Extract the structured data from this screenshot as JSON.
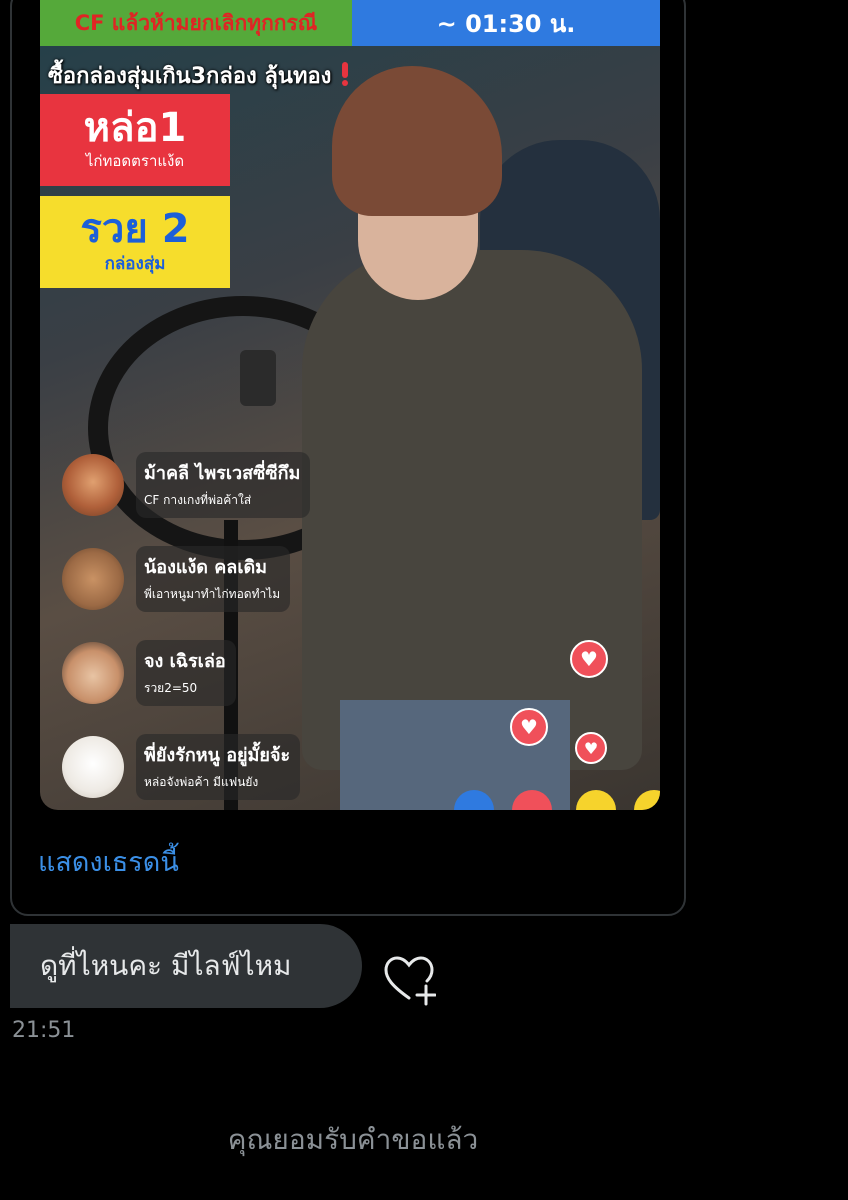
{
  "tweet": {
    "banner_left": "CF แล้วห้ามยกเลิกทุกกรณี",
    "banner_right": "~ 01:30 น.",
    "headline": "ซื้อกล่องสุ่มเกิน3กล่อง ลุ้นทอง",
    "red_box": {
      "title": "หล่อ1",
      "subtitle": "ไก่ทอดตราแง้ด"
    },
    "yellow_box": {
      "title": "รวย 2",
      "subtitle": "กล่องสุ่ม"
    },
    "comments": [
      {
        "name": "ม้าคลี ไพรเวสซี่ซีกึม",
        "text": "CF กางเกงที่พ่อค้าใส่"
      },
      {
        "name": "น้องแง้ด คลเดิม",
        "text": "พี่เอาหนูมาทำไก่ทอดทำไม"
      },
      {
        "name": "จง เฉิรเล่อ",
        "text": "รวย2=50"
      },
      {
        "name": "พี่ยังรักหนู อยู่มั้ยจ้ะ",
        "text": "หล่อจังพ่อค้า มีแฟนยัง"
      }
    ],
    "show_thread": "แสดงเธรดนี้"
  },
  "message": {
    "text": "ดูที่ไหนคะ มีไลฟ์ไหม",
    "time": "21:51"
  },
  "status": {
    "accepted": "คุณยอมรับคำขอแล้ว"
  },
  "icons": {
    "reaction_heart": "heart-icon",
    "add_reaction": "heart-plus-icon",
    "fire": "fire-icon"
  },
  "colors": {
    "background": "#000000",
    "link": "#3b8fe6",
    "bubble": "#2f3336",
    "muted_text": "#8b9196",
    "banner_green": "#55a93a",
    "banner_blue": "#2f7ae0",
    "red_box": "#e8343f",
    "yellow_box": "#f6dd2c"
  }
}
